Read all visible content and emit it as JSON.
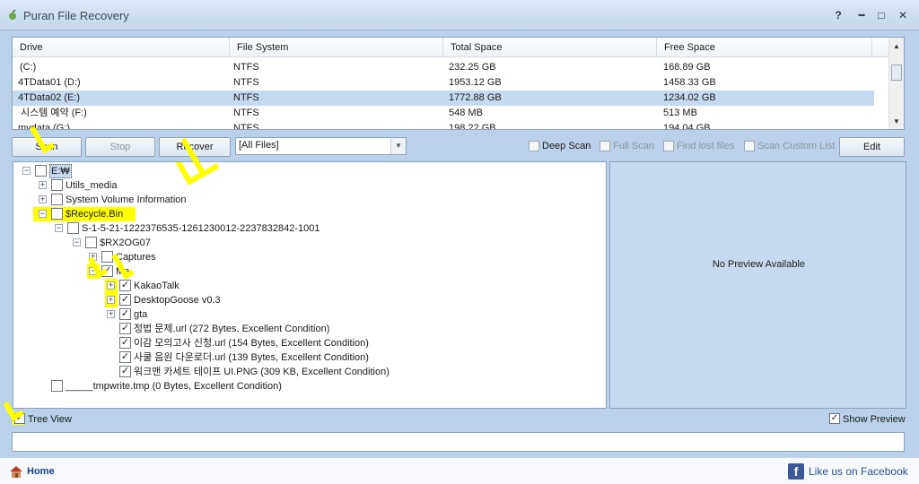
{
  "window": {
    "title": "Puran File Recovery",
    "controls": {
      "help": "?",
      "minimize": "▬",
      "maximize": "□",
      "close": "✕"
    }
  },
  "drives": {
    "columns": [
      "Drive",
      "File System",
      "Total Space",
      "Free Space"
    ],
    "rows": [
      {
        "drive": " (C:)",
        "fs": "NTFS",
        "total": "232.25 GB",
        "free": "168.89 GB"
      },
      {
        "drive": "4TData01 (D:)",
        "fs": "NTFS",
        "total": "1953.12 GB",
        "free": "1458.33 GB"
      },
      {
        "drive": "4TData02 (E:)",
        "fs": "NTFS",
        "total": "1772.88 GB",
        "free": "1234.02 GB"
      },
      {
        "drive": "시스템 예약 (F:)",
        "fs": "NTFS",
        "total": "548 MB",
        "free": "513 MB"
      },
      {
        "drive": "mydata (G:)",
        "fs": "NTFS",
        "total": "198.22 GB",
        "free": "194.04 GB"
      }
    ]
  },
  "toolbar": {
    "scan": "Scan",
    "stop": "Stop",
    "recover": "Recover",
    "filter_value": "[All Files]",
    "deep_scan": "Deep Scan",
    "full_scan": "Full Scan",
    "find_lost_files": "Find lost files",
    "scan_custom_list": "Scan Custom List",
    "edit": "Edit"
  },
  "tree": {
    "nodes": [
      {
        "label": "E:₩",
        "checked": false,
        "expander": "−"
      },
      {
        "label": "Utils_media",
        "checked": false,
        "expander": "+"
      },
      {
        "label": "System Volume Information",
        "checked": false,
        "expander": "+"
      },
      {
        "label": "$Recycle.Bin",
        "checked": false,
        "expander": "−"
      },
      {
        "label": "S-1-5-21-1222376535-1261230012-2237832842-1001",
        "checked": false,
        "expander": "−"
      },
      {
        "label": "$RX2OG07",
        "checked": false,
        "expander": "−"
      },
      {
        "label": "Captures",
        "checked": false,
        "expander": "+"
      },
      {
        "label": "Me",
        "checked": true,
        "expander": "−"
      },
      {
        "label": "KakaoTalk",
        "checked": true,
        "expander": "+"
      },
      {
        "label": "DesktopGoose v0.3",
        "checked": true,
        "expander": "+"
      },
      {
        "label": "gta",
        "checked": true,
        "expander": "+"
      },
      {
        "label": "정법 문제.url  (272 Bytes, Excellent Condition)",
        "checked": true,
        "expander": ""
      },
      {
        "label": "이감 모의고사 신청.url  (154 Bytes, Excellent Condition)",
        "checked": true,
        "expander": ""
      },
      {
        "label": "사쿨 음원 다운로더.url  (139 Bytes, Excellent Condition)",
        "checked": true,
        "expander": ""
      },
      {
        "label": "워크맨 카세트 테이프 UI.PNG  (309 KB, Excellent Condition)",
        "checked": true,
        "expander": ""
      },
      {
        "label": "_____tmpwrite.tmp  (0 Bytes, Excellent Condition)",
        "checked": false,
        "expander": ""
      }
    ]
  },
  "preview": {
    "message": "No Preview Available"
  },
  "options": {
    "tree_view": "Tree View",
    "show_preview": "Show Preview"
  },
  "footer": {
    "home": "Home",
    "facebook": "Like us on Facebook"
  },
  "colors": {
    "highlight": "#ffff00",
    "window_bg": "#b9d1ea",
    "selection": "#c5d9f1"
  }
}
